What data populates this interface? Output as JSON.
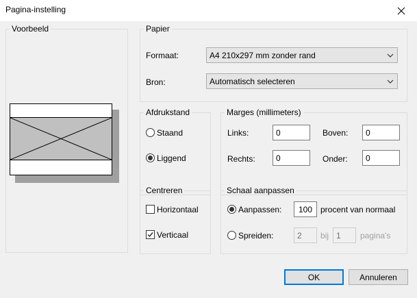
{
  "window": {
    "title": "Pagina-instelling"
  },
  "preview": {
    "legend": "Voorbeeld"
  },
  "paper": {
    "legend": "Papier",
    "format_label": "Formaat:",
    "format_value": "A4 210x297 mm zonder rand",
    "source_label": "Bron:",
    "source_value": "Automatisch selecteren"
  },
  "orientation": {
    "legend": "Afdrukstand",
    "portrait_label": "Staand",
    "landscape_label": "Liggend",
    "selected": "landscape"
  },
  "margins": {
    "legend": "Marges (millimeters)",
    "left_label": "Links:",
    "left_value": "0",
    "top_label": "Boven:",
    "top_value": "0",
    "right_label": "Rechts:",
    "right_value": "0",
    "bottom_label": "Onder:",
    "bottom_value": "0"
  },
  "center": {
    "legend": "Centreren",
    "horizontal_label": "Horizontaal",
    "horizontal_checked": false,
    "vertical_label": "Verticaal",
    "vertical_checked": true
  },
  "scale": {
    "legend": "Schaal aanpassen",
    "adjust_label": "Aanpassen:",
    "adjust_value": "100",
    "adjust_suffix": "procent van normaal",
    "fit_label": "Spreiden:",
    "fit_width_value": "2",
    "fit_by_label": "bij",
    "fit_height_value": "1",
    "fit_suffix": "pagina's",
    "selected": "adjust"
  },
  "buttons": {
    "ok_label": "OK",
    "cancel_label": "Annuleren"
  },
  "colors": {
    "accent": "#0078d7",
    "window_bg": "#f0f0f0",
    "preview_fill": "#c0c0c0"
  }
}
